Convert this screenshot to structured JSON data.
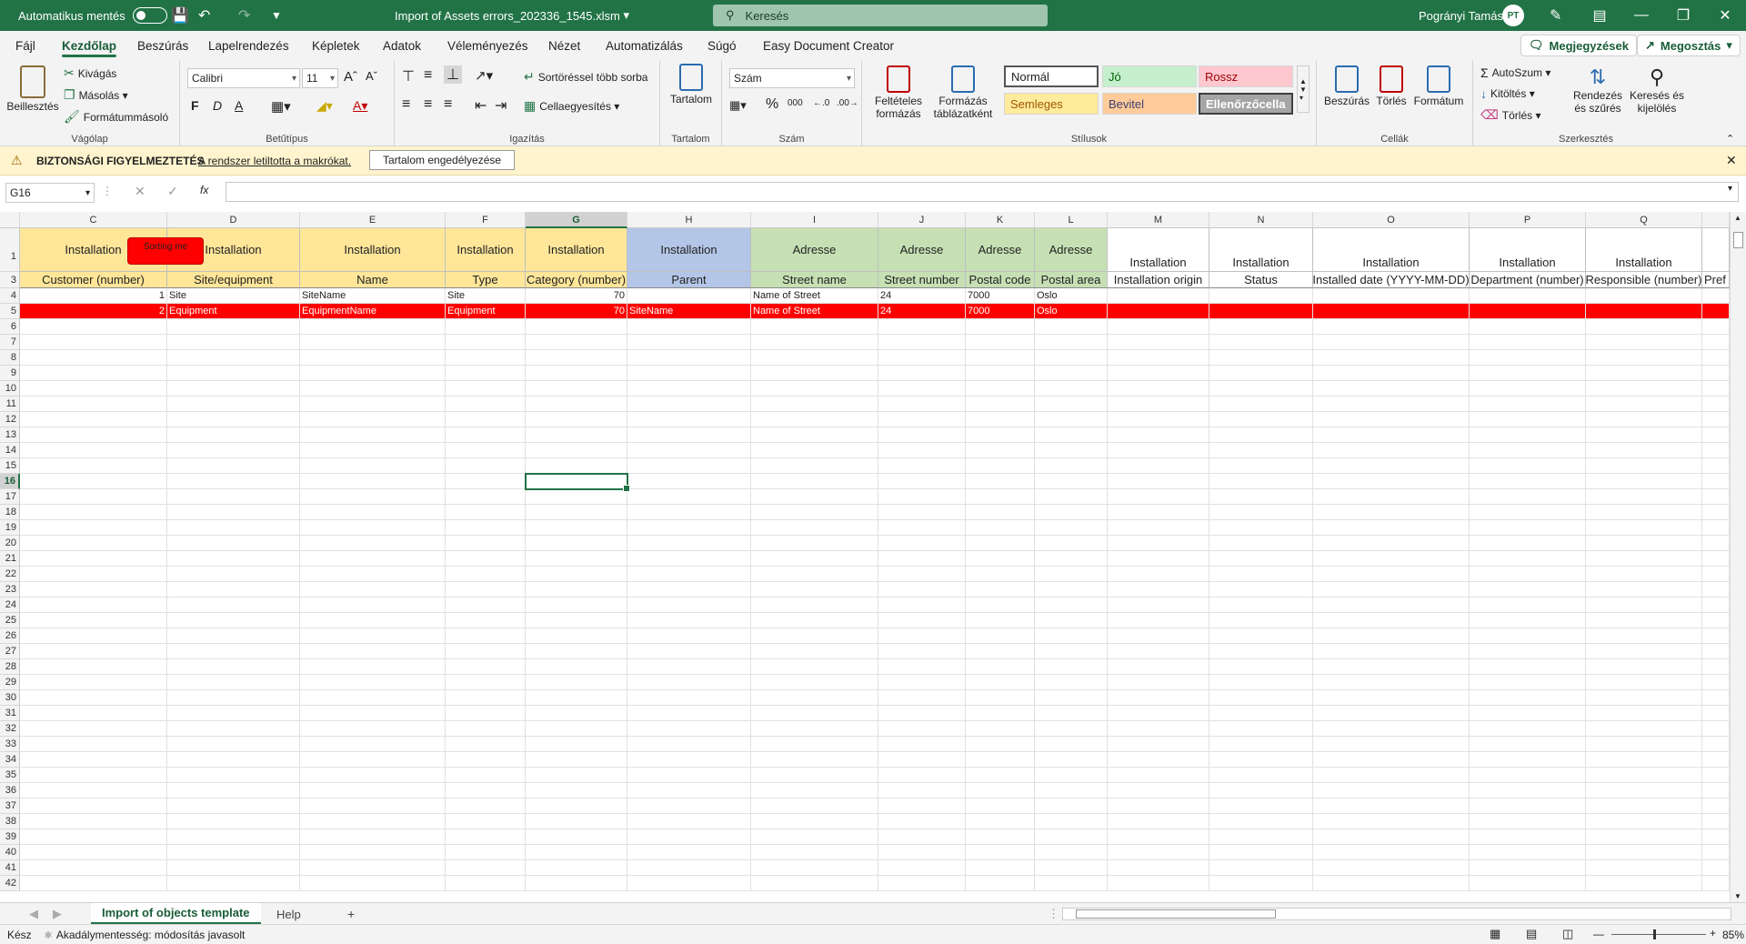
{
  "titlebar": {
    "autosave_label": "Automatikus mentés",
    "filename": "Import of Assets errors_202336_1545.xlsm",
    "search_placeholder": "Keresés",
    "user_name": "Pogrányi Tamás",
    "user_initials": "PT"
  },
  "menu": {
    "items": [
      "Fájl",
      "Kezdőlap",
      "Beszúrás",
      "Lapelrendezés",
      "Képletek",
      "Adatok",
      "Véleményezés",
      "Nézet",
      "Automatizálás",
      "Súgó",
      "Easy Document Creator"
    ],
    "comments": "Megjegyzések",
    "share": "Megosztás"
  },
  "ribbon": {
    "clipboard": {
      "paste": "Beillesztés",
      "cut": "Kivágás",
      "copy": "Másolás",
      "format_painter": "Formátummásoló",
      "label": "Vágólap"
    },
    "font": {
      "name": "Calibri",
      "size": "11",
      "bold": "F",
      "italic": "D",
      "underline": "A",
      "label": "Betűtípus"
    },
    "alignment": {
      "wrap": "Sortöréssel több sorba",
      "merge": "Cellaegyesítés",
      "label": "Igazítás"
    },
    "content": {
      "button": "Tartalom",
      "label": "Tartalom"
    },
    "number": {
      "format": "Szám",
      "label": "Szám"
    },
    "styles": {
      "cond_format": "Feltételes formázás",
      "as_table": "Formázás táblázatként",
      "normal": "Normál",
      "good": "Jó",
      "bad": "Rossz",
      "neutral": "Semleges",
      "input": "Bevitel",
      "check": "Ellenőrzőcella",
      "label": "Stílusok"
    },
    "cells": {
      "insert": "Beszúrás",
      "delete": "Törlés",
      "format": "Formátum",
      "label": "Cellák"
    },
    "editing": {
      "autosum": "AutoSzum",
      "fill": "Kitöltés",
      "clear": "Törlés",
      "sort": "Rendezés és szűrés",
      "find": "Keresés és kijelölés",
      "label": "Szerkesztés"
    }
  },
  "security_bar": {
    "title": "BIZTONSÁGI FIGYELMEZTETÉS",
    "message": "A rendszer letiltotta a makrókat.",
    "button": "Tartalom engedélyezése"
  },
  "formula_bar": {
    "name_box": "G16",
    "fx": "fx",
    "value": ""
  },
  "sheet": {
    "columns": [
      "C",
      "D",
      "E",
      "F",
      "G",
      "H",
      "I",
      "J",
      "K",
      "L",
      "M",
      "N",
      "O",
      "P",
      "Q"
    ],
    "row1": [
      "Installation",
      "Installation",
      "Installation",
      "Installation",
      "Installation",
      "Installation",
      "Adresse",
      "Adresse",
      "Adresse",
      "Adresse",
      "Installation",
      "Installation",
      "Installation",
      "Installation",
      "Installation"
    ],
    "row3": [
      "Customer (number)",
      "Site/equipment",
      "Name",
      "Type",
      "Category (number)",
      "Parent",
      "Street name",
      "Street number",
      "Postal code",
      "Postal area",
      "Installation origin",
      "Status",
      "Installed date (YYYY-MM-DD)",
      "Department (number)",
      "Responsible (number)",
      "Pref"
    ],
    "row4": [
      "1",
      "Site",
      "SiteName",
      "Site",
      "70",
      "",
      "Name of Street",
      "24",
      "7000",
      "Oslo"
    ],
    "row5": [
      "2",
      "Equipment",
      "EquipmentName",
      "Equipment",
      "70",
      "SiteName",
      "Name of Street",
      "24",
      "7000",
      "Oslo"
    ],
    "sort_button": "Sorting me",
    "row_numbers": [
      "1",
      "3",
      "4",
      "5",
      "6",
      "7",
      "8",
      "9",
      "10",
      "11",
      "12",
      "13",
      "14",
      "15",
      "16",
      "17",
      "18",
      "19",
      "20",
      "21",
      "22",
      "23",
      "24",
      "25",
      "26",
      "27",
      "28",
      "29",
      "30",
      "31",
      "32",
      "33",
      "34",
      "35",
      "36",
      "37",
      "38",
      "39",
      "40",
      "41",
      "42"
    ]
  },
  "tabs": {
    "items": [
      "Import of objects template",
      "Help"
    ],
    "add": "+"
  },
  "status": {
    "ready": "Kész",
    "accessibility": "Akadálymentesség: módosítás javasolt",
    "zoom": "85%"
  },
  "colors": {
    "accent": "#217346",
    "header_yellow": "#ffe699",
    "header_blue": "#b4c6e7",
    "header_green": "#c6e0b4",
    "error_red": "#ff0000"
  }
}
